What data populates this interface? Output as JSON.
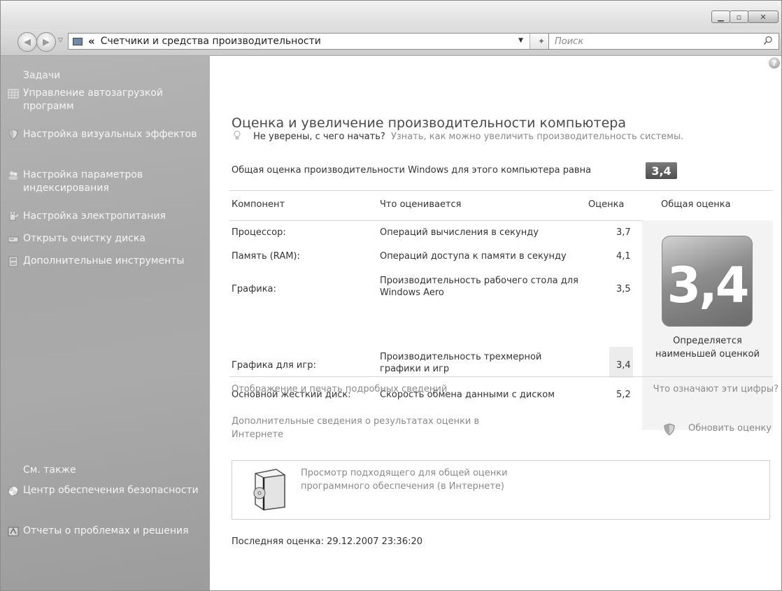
{
  "address": {
    "breadcrumb_chevron": "«",
    "path": "Счетчики и средства производительности",
    "search_placeholder": "Поиск"
  },
  "sidebar": {
    "tasks_heading": "Задачи",
    "tasks": [
      {
        "label": "Управление автозагрузкой программ",
        "icon": "startup-icon"
      },
      {
        "label": "Настройка визуальных эффектов",
        "icon": "shield-icon"
      },
      {
        "label": "Настройка параметров индексирования",
        "icon": "indexing-icon"
      },
      {
        "label": "Настройка электропитания",
        "icon": "power-icon"
      },
      {
        "label": "Открыть очистку диска",
        "icon": "disk-cleanup-icon"
      },
      {
        "label": "Дополнительные инструменты",
        "icon": "tools-icon"
      }
    ],
    "see_also_heading": "См. также",
    "see_also": [
      {
        "label": "Центр обеспечения безопасности",
        "icon": "security-center-icon"
      },
      {
        "label": "Отчеты о проблемах и решения",
        "icon": "problem-reports-icon"
      }
    ]
  },
  "main": {
    "title": "Оценка и увеличение производительности компьютера",
    "tip_question": "Не уверены, с чего начать?",
    "tip_link": "Узнать, как можно увеличить производительность системы.",
    "overall_text": "Общая оценка производительности Windows для этого компьютера равна",
    "overall_score": "3,4",
    "table": {
      "headers": [
        "Компонент",
        "Что оценивается",
        "Оценка",
        "Общая оценка"
      ],
      "rows": [
        {
          "component": "Процессор:",
          "what": "Операций вычисления в секунду",
          "score": "3,7"
        },
        {
          "component": "Память (RAM):",
          "what": "Операций доступа к памяти в секунду",
          "score": "4,1"
        },
        {
          "component": "Графика:",
          "what": "Производительность рабочего стола для Windows Aero",
          "score": "3,5"
        },
        {
          "component": "Графика для игр:",
          "what": "Производительность трехмерной графики и игр",
          "score": "3,4"
        },
        {
          "component": "Основной жесткий диск:",
          "what": "Скорость обмена данными с диском",
          "score": "5,2"
        }
      ],
      "big_score": "3,4",
      "big_caption": "Определяется наименьшей оценкой"
    },
    "link_details": "Отображение и печать подробных сведений",
    "link_meaning": "Что означают эти цифры?",
    "link_online": "Дополнительные сведения о результатах оценки в Интернете",
    "link_update": "Обновить оценку",
    "software_text": "Просмотр подходящего для общей оценки программного обеспечения (в Интернете)",
    "last_rating": "Последняя оценка: 29.12.2007 23:36:20"
  }
}
